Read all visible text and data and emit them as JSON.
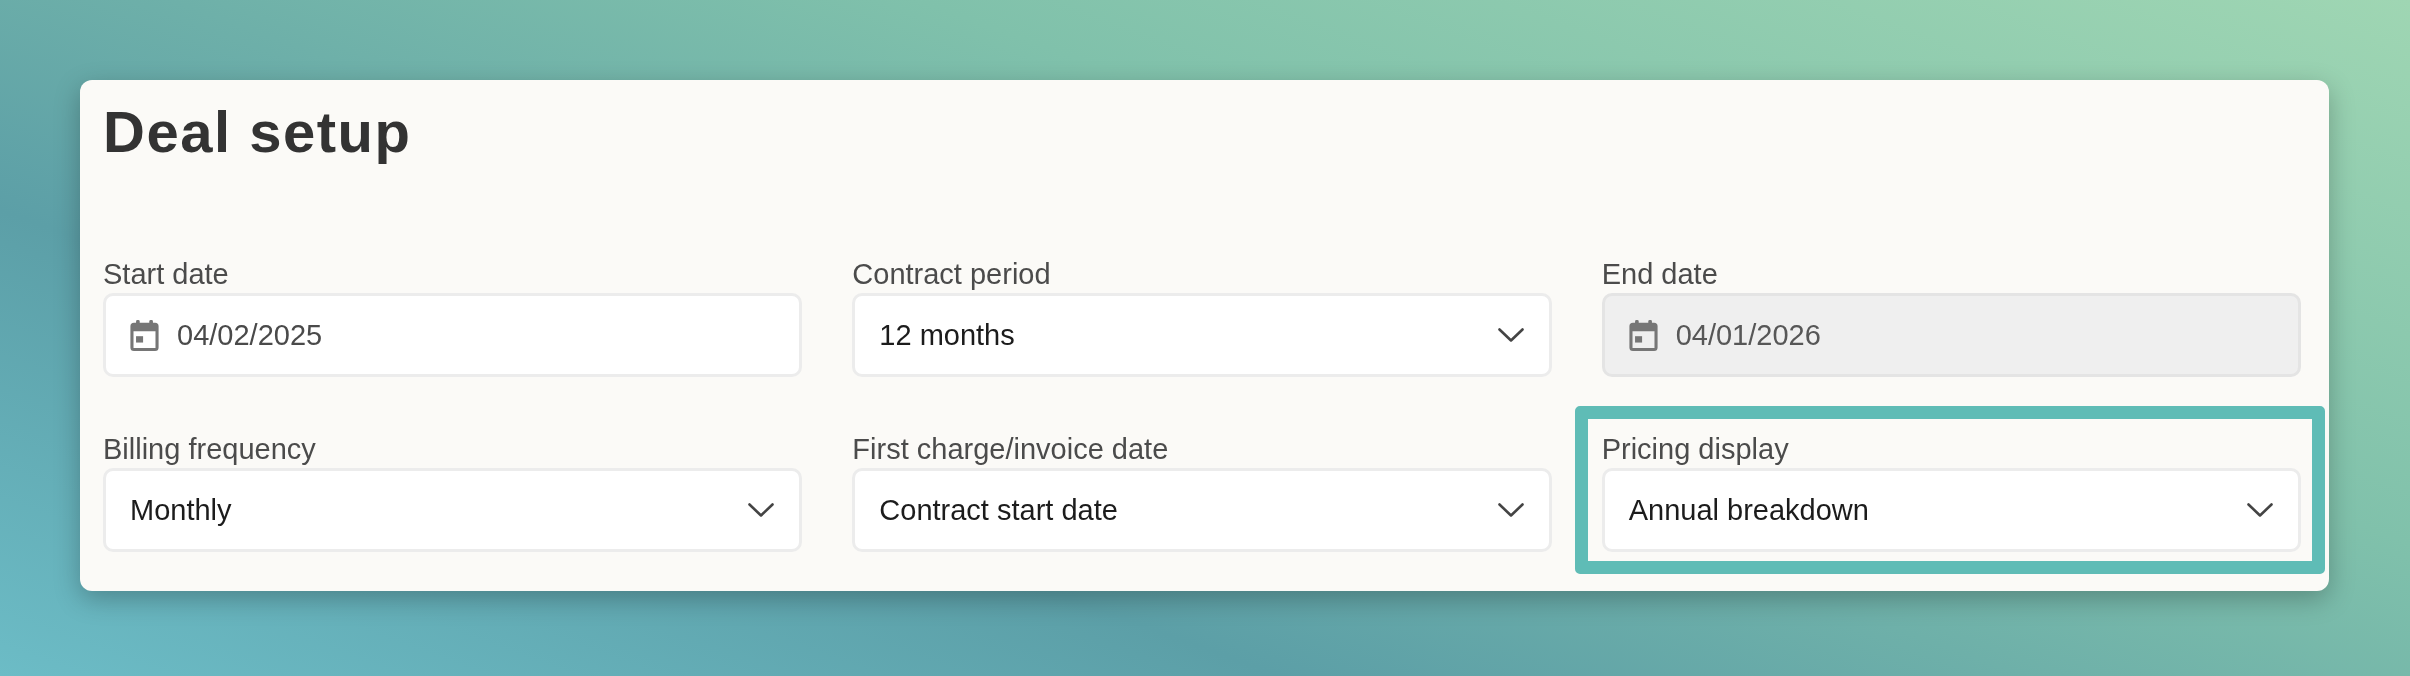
{
  "title": "Deal setup",
  "fields": [
    {
      "kind": "date",
      "label": "Start date",
      "value": "04/02/2025",
      "disabled": false,
      "highlighted": false
    },
    {
      "kind": "select",
      "label": "Contract period",
      "value": "12 months",
      "disabled": false,
      "highlighted": false
    },
    {
      "kind": "date",
      "label": "End date",
      "value": "04/01/2026",
      "disabled": true,
      "highlighted": false
    },
    {
      "kind": "select",
      "label": "Billing frequency",
      "value": "Monthly",
      "disabled": false,
      "highlighted": false
    },
    {
      "kind": "select",
      "label": "First charge/invoice date",
      "value": "Contract start date",
      "disabled": false,
      "highlighted": false
    },
    {
      "kind": "select",
      "label": "Pricing display",
      "value": "Annual breakdown",
      "disabled": false,
      "highlighted": true
    }
  ]
}
